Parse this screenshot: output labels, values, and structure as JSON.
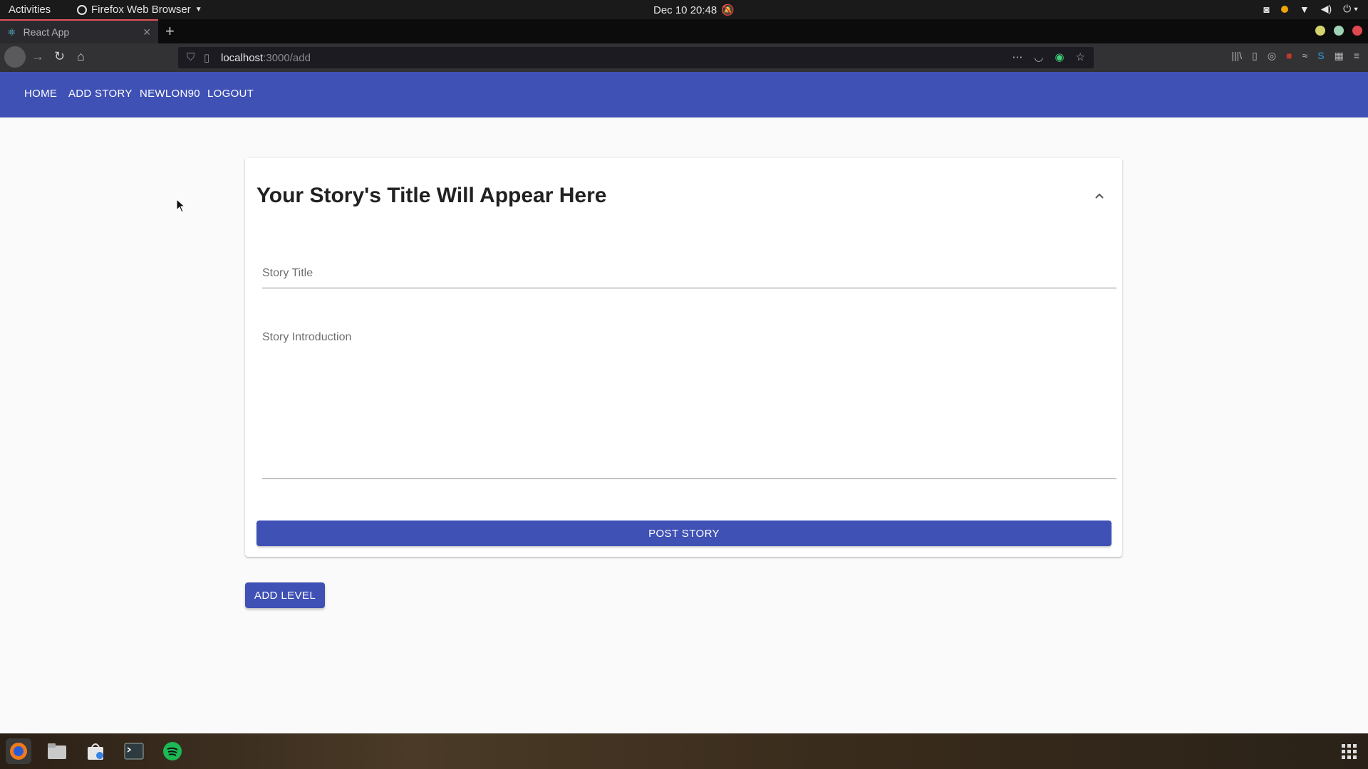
{
  "system": {
    "activities": "Activities",
    "app_name": "Firefox Web Browser",
    "clock": "Dec 10  20:48"
  },
  "browser": {
    "tab_title": "React App",
    "url_host": "localhost",
    "url_path": ":3000/add"
  },
  "nav": {
    "items": [
      "HOME",
      "ADD STORY",
      "NEWLON90",
      "LOGOUT"
    ]
  },
  "story_card": {
    "title": "Your Story's Title Will Appear Here",
    "title_field_label": "Story Title",
    "intro_field_label": "Story Introduction",
    "post_button": "POST STORY"
  },
  "add_level_button": "ADD LEVEL",
  "colors": {
    "primary": "#3f51b5",
    "background": "#fafafa"
  }
}
